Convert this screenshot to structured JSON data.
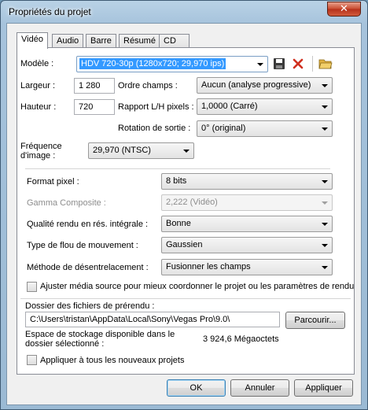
{
  "window": {
    "title": "Propriétés du projet",
    "close_glyph": "✕"
  },
  "tabs": [
    "Vidéo",
    "Audio",
    "Barre",
    "Résumé",
    "CD audio"
  ],
  "video": {
    "model_label": "Modèle :",
    "model_value": "HDV 720-30p (1280x720; 29,970 ips)",
    "width_label": "Largeur :",
    "width_value": "1 280",
    "height_label": "Hauteur :",
    "height_value": "720",
    "field_order_label": "Ordre champs :",
    "field_order_value": "Aucun (analyse progressive)",
    "pixel_ratio_label": "Rapport L/H pixels :",
    "pixel_ratio_value": "1,0000 (Carré)",
    "rotation_label": "Rotation de sortie :",
    "rotation_value": "0° (original)",
    "frame_rate_label_1": "Fréquence",
    "frame_rate_label_2": "d'image :",
    "frame_rate_value": "29,970 (NTSC)",
    "pixel_format_label": "Format pixel :",
    "pixel_format_value": "8 bits",
    "gamma_label": "Gamma Composite :",
    "gamma_value": "2,222 (Vidéo)",
    "render_quality_label": "Qualité rendu en rés. intégrale :",
    "render_quality_value": "Bonne",
    "motion_blur_label": "Type de flou de mouvement :",
    "motion_blur_value": "Gaussien",
    "deinterlace_label": "Méthode de désentrelacement :",
    "deinterlace_value": "Fusionner les champs",
    "adjust_media_label": "Ajuster média source pour mieux coordonner le projet ou les paramètres de rendu",
    "prerender_folder_label": "Dossier des fichiers de prérendu :",
    "prerender_folder_value": "C:\\Users\\tristan\\AppData\\Local\\Sony\\Vegas Pro\\9.0\\",
    "browse_label": "Parcourir...",
    "storage_label_1": "Espace de stockage disponible dans le",
    "storage_label_2": "dossier sélectionné :",
    "storage_value": "3 924,6 Mégaoctets",
    "apply_all_label": "Appliquer à tous les nouveaux projets"
  },
  "buttons": {
    "ok": "OK",
    "cancel": "Annuler",
    "apply": "Appliquer"
  },
  "icons": [
    "save-icon",
    "delete-icon",
    "folder-open-icon"
  ],
  "colors": {
    "selection": "#3399ff",
    "delete_icon": "#d03020",
    "folder_icon": "#e0b040"
  }
}
